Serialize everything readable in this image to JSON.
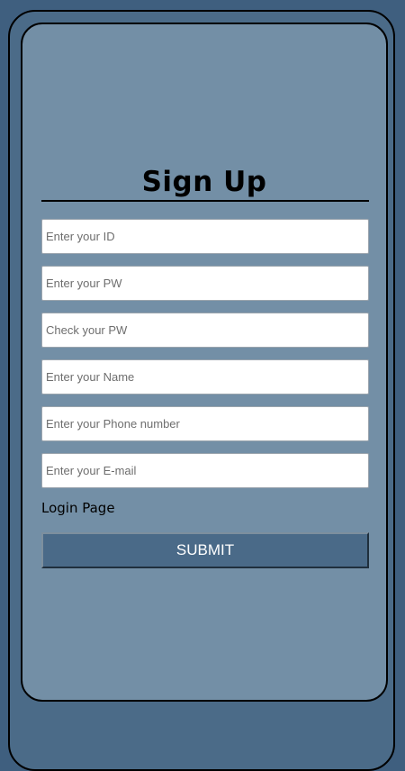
{
  "form": {
    "title": "Sign Up",
    "fields": [
      {
        "placeholder": "Enter your ID"
      },
      {
        "placeholder": "Enter your PW"
      },
      {
        "placeholder": "Check your PW"
      },
      {
        "placeholder": "Enter your Name"
      },
      {
        "placeholder": "Enter your Phone number"
      },
      {
        "placeholder": "Enter your E-mail"
      }
    ],
    "login_link": "Login Page",
    "submit_label": "SUBMIT"
  },
  "colors": {
    "page_background": "#3f5f7f",
    "device_background": "#4b6b88",
    "screen_background": "#738fa6",
    "submit_background": "#4a6a88"
  }
}
